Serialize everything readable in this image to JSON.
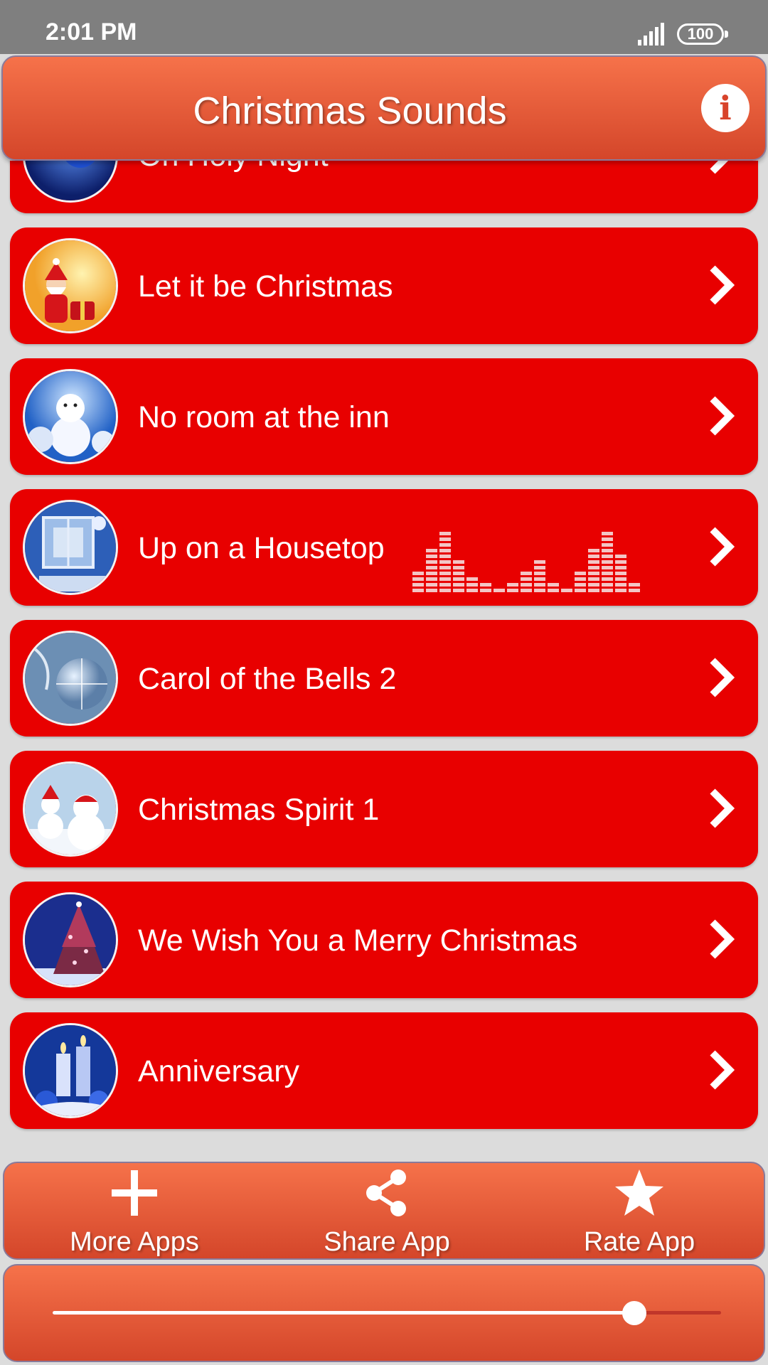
{
  "status_bar": {
    "time": "2:01 PM",
    "battery": "100"
  },
  "app_bar": {
    "title": "Christmas Sounds",
    "info_icon": "info-icon"
  },
  "list": {
    "items": [
      {
        "label": "Oh Holy Night",
        "thumb": "blue-ornament"
      },
      {
        "label": "Let it be Christmas",
        "thumb": "santa"
      },
      {
        "label": "No room at the inn",
        "thumb": "snowman-blue"
      },
      {
        "label": "Up on a Housetop",
        "thumb": "window-snow",
        "playing": true
      },
      {
        "label": "Carol of the Bells 2",
        "thumb": "disco-ornament"
      },
      {
        "label": "Christmas Spirit 1",
        "thumb": "snowmen"
      },
      {
        "label": "We Wish You a Merry Christmas",
        "thumb": "christmas-tree"
      },
      {
        "label": "Anniversary",
        "thumb": "candles"
      }
    ]
  },
  "bottom_bar": {
    "more_apps": "More Apps",
    "share_app": "Share App",
    "rate_app": "Rate App"
  },
  "player": {
    "progress": 0.87
  },
  "colors": {
    "item_bg": "#e80000",
    "bar_top": "#f6724a",
    "bar_bottom": "#d4462a",
    "page_bg": "#dcdcdc"
  }
}
